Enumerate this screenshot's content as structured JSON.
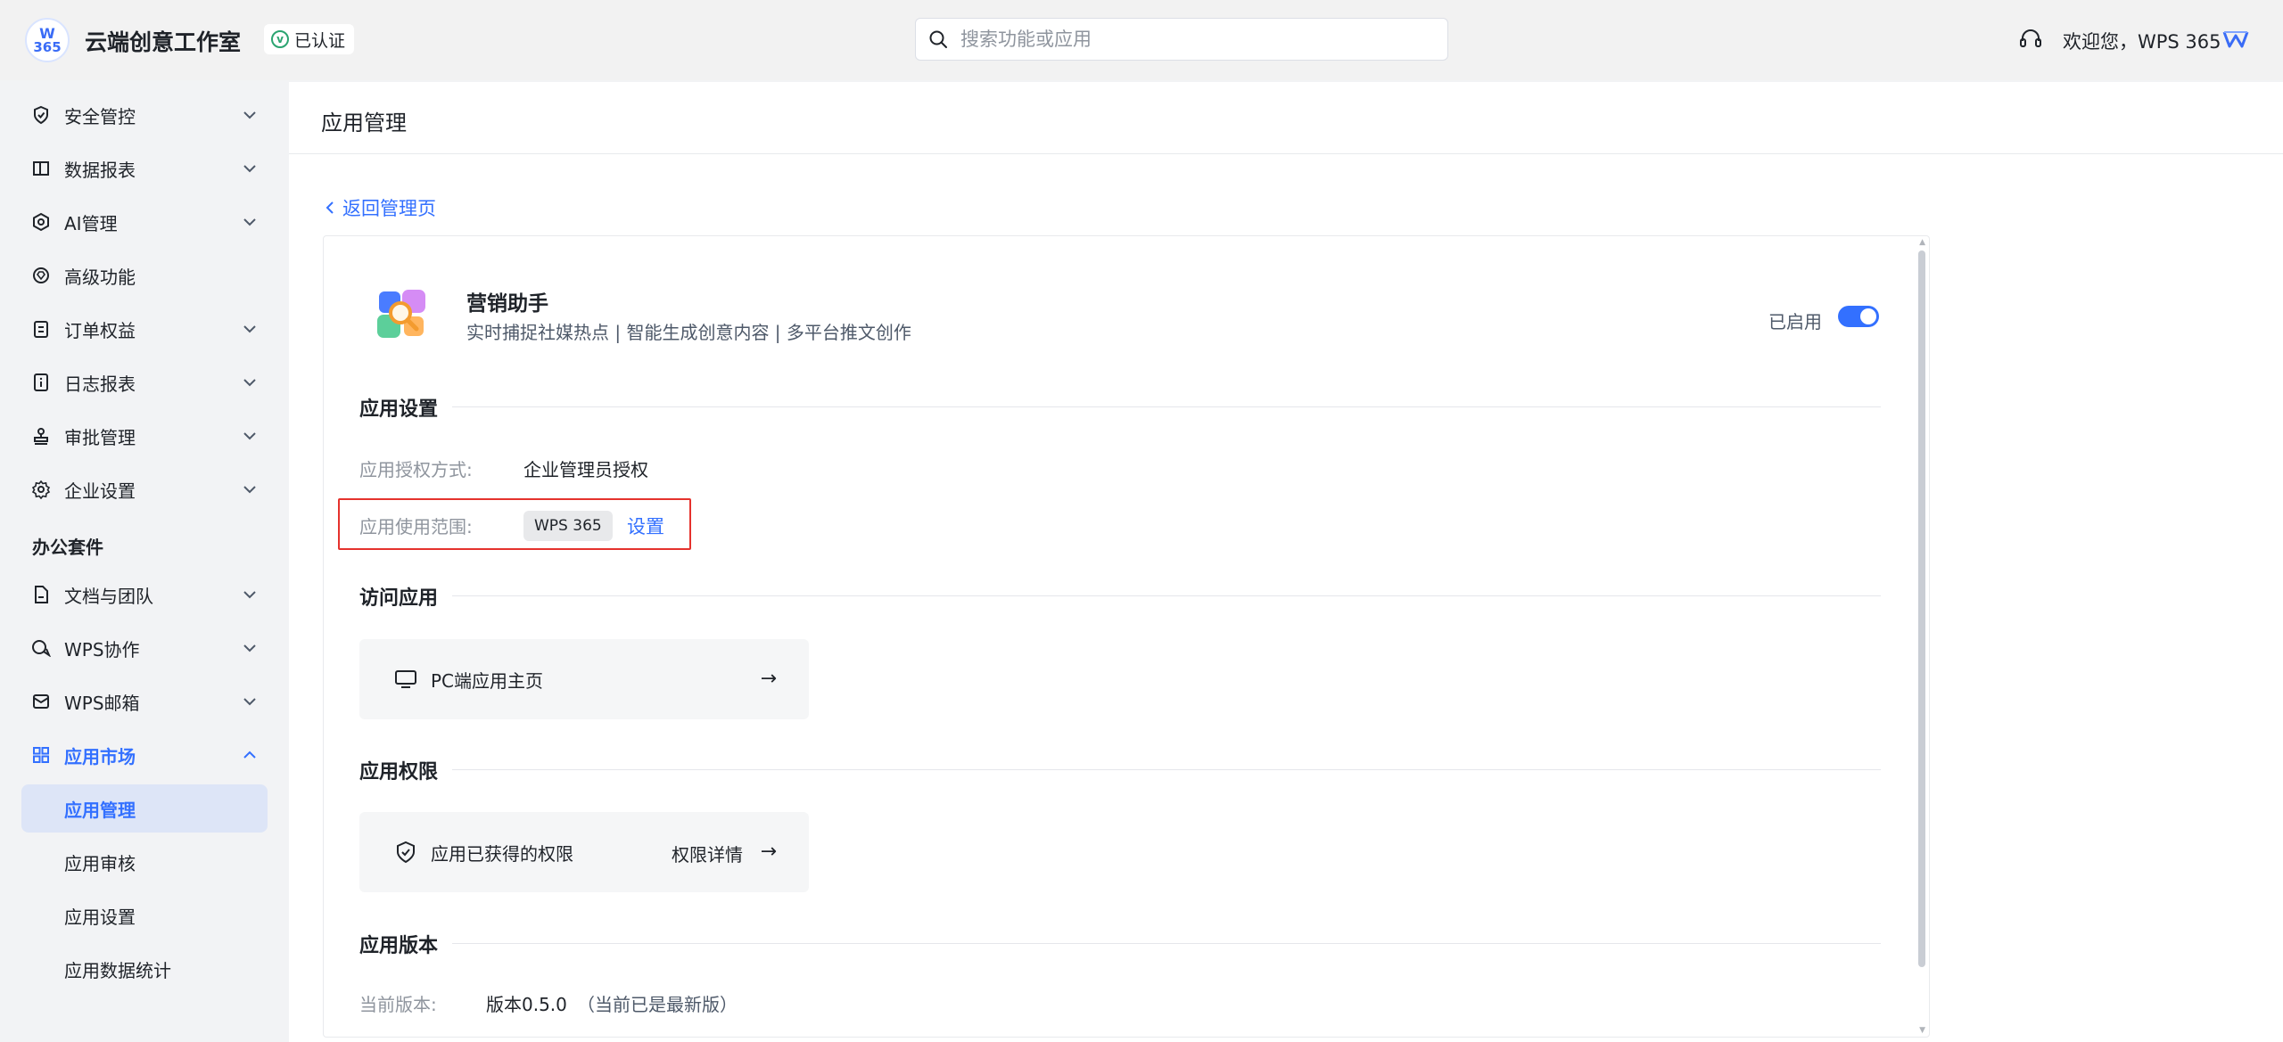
{
  "header": {
    "logo_top": "W",
    "logo_bottom": "365",
    "org_name": "云端创意工作室",
    "verified_label": "已认证",
    "search_placeholder": "搜索功能或应用",
    "welcome_text": "欢迎您，WPS 365"
  },
  "sidebar": {
    "items": [
      {
        "label": "安全管控",
        "icon": "shield-icon"
      },
      {
        "label": "数据报表",
        "icon": "book-icon"
      },
      {
        "label": "AI管理",
        "icon": "ai-hexagon-icon"
      },
      {
        "label": "高级功能",
        "icon": "diamond-icon"
      },
      {
        "label": "订单权益",
        "icon": "clipboard-icon"
      },
      {
        "label": "日志报表",
        "icon": "log-icon"
      },
      {
        "label": "审批管理",
        "icon": "stamp-icon"
      },
      {
        "label": "企业设置",
        "icon": "gear-icon"
      }
    ],
    "office_section_title": "办公套件",
    "office_items": [
      {
        "label": "文档与团队",
        "icon": "document-icon"
      },
      {
        "label": "WPS协作",
        "icon": "chat-icon"
      },
      {
        "label": "WPS邮箱",
        "icon": "mail-icon"
      }
    ],
    "app_market": {
      "label": "应用市场",
      "icon": "grid-icon",
      "children": [
        "应用管理",
        "应用审核",
        "应用设置",
        "应用数据统计"
      ],
      "active_child": "应用管理"
    }
  },
  "main": {
    "page_title": "应用管理",
    "back_label": "返回管理页",
    "app": {
      "name": "营销助手",
      "description": "实时捕捉社媒热点 | 智能生成创意内容 | 多平台推文创作",
      "status_label": "已启用",
      "enabled": true
    },
    "settings": {
      "title": "应用设置",
      "auth_label": "应用授权方式:",
      "auth_value": "企业管理员授权",
      "scope_label": "应用使用范围:",
      "scope_tag": "WPS 365",
      "scope_action": "设置"
    },
    "access": {
      "title": "访问应用",
      "pc_home_label": "PC端应用主页"
    },
    "permissions": {
      "title": "应用权限",
      "granted_label": "应用已获得的权限",
      "detail_label": "权限详情"
    },
    "version": {
      "title": "应用版本",
      "current_label": "当前版本:",
      "current_value": "版本0.5.0",
      "latest_note": "（当前已是最新版）"
    }
  },
  "colors": {
    "accent": "#3370ff",
    "highlight_border": "#e5322d",
    "verified": "#2ba471"
  }
}
